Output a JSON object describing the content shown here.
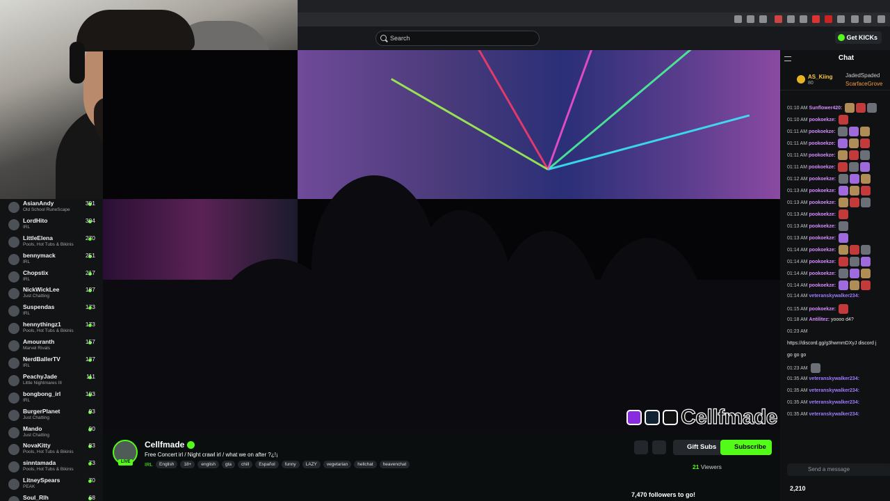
{
  "topnav": {
    "search_placeholder": "Search",
    "get_kicks_label": "Get KICKs"
  },
  "following": [
    {
      "name": "AsianAndy",
      "category": "Old School RuneScape",
      "viewers": "391"
    },
    {
      "name": "LordHito",
      "category": "IRL",
      "viewers": "304"
    },
    {
      "name": "LittleElena",
      "category": "Pools, Hot Tubs & Bikinis",
      "viewers": "270"
    },
    {
      "name": "bennymack",
      "category": "IRL",
      "viewers": "251"
    },
    {
      "name": "Chopstix",
      "category": "IRL",
      "viewers": "217"
    },
    {
      "name": "NickWickLee",
      "category": "Just Chatting",
      "viewers": "187"
    },
    {
      "name": "Suspendas",
      "category": "IRL",
      "viewers": "173"
    },
    {
      "name": "hennythingz1",
      "category": "Pools, Hot Tubs & Bikinis",
      "viewers": "173"
    },
    {
      "name": "Amouranth",
      "category": "Marvel Rivals",
      "viewers": "157"
    },
    {
      "name": "NerdBallerTV",
      "category": "IRL",
      "viewers": "137"
    },
    {
      "name": "PeachyJade",
      "category": "Little Nightmares III",
      "viewers": "111"
    },
    {
      "name": "bongbong_irl",
      "category": "IRL",
      "viewers": "103"
    },
    {
      "name": "BurgerPlanet",
      "category": "Just Chatting",
      "viewers": "93"
    },
    {
      "name": "Mando",
      "category": "Just Chatting",
      "viewers": "90"
    },
    {
      "name": "NovaKitty",
      "category": "Pools, Hot Tubs & Bikinis",
      "viewers": "83"
    },
    {
      "name": "sinntamada",
      "category": "Pools, Hot Tubs & Bikinis",
      "viewers": "73"
    },
    {
      "name": "LitneySpears",
      "category": "PEAK",
      "viewers": "70"
    },
    {
      "name": "Soul_Rlh",
      "category": "",
      "viewers": "68"
    }
  ],
  "video": {
    "overlay_name": "Cellfmade"
  },
  "stream": {
    "streamer": "Cellfmade",
    "live_badge": "LIVE",
    "title": "Free Concert irl / Night crawl irl / what we on after ?¿!¡",
    "category": "IRL",
    "tags": [
      "English",
      "18+",
      "english",
      "gta",
      "chill",
      "Español",
      "funny",
      "LAZY",
      "vegetarian",
      "hellchat",
      "heavenchat"
    ],
    "gift_subs_label": "Gift Subs",
    "subscribe_label": "Subscribe",
    "viewers_count": "21",
    "viewers_label": "Viewers",
    "followers_goal": "7,470 followers to go!"
  },
  "chat": {
    "title": "Chat",
    "gifters": [
      {
        "name": "AS_Kiing",
        "amount": "80"
      },
      {
        "name": "JadedSpaded"
      },
      {
        "name": "ScarfaceGrove"
      }
    ],
    "messages": [
      {
        "time": "01:10 AM",
        "user": "Sunflower420:",
        "text": "",
        "color": "#d58cff",
        "emotes": 3
      },
      {
        "time": "01:10 AM",
        "user": "pookoekze:",
        "text": "",
        "color": "#d58cff",
        "emotes": 1
      },
      {
        "time": "01:11 AM",
        "user": "pookoekze:",
        "text": "",
        "color": "#d58cff",
        "emotes": 3
      },
      {
        "time": "01:11 AM",
        "user": "pookoekze:",
        "text": "",
        "color": "#d58cff",
        "emotes": 3
      },
      {
        "time": "01:11 AM",
        "user": "pookoekze:",
        "text": "",
        "color": "#d58cff",
        "emotes": 3
      },
      {
        "time": "01:11 AM",
        "user": "pookoekze:",
        "text": "",
        "color": "#d58cff",
        "emotes": 3
      },
      {
        "time": "01:12 AM",
        "user": "pookoekze:",
        "text": "",
        "color": "#d58cff",
        "emotes": 3
      },
      {
        "time": "01:13 AM",
        "user": "pookoekze:",
        "text": "",
        "color": "#d58cff",
        "emotes": 3
      },
      {
        "time": "01:13 AM",
        "user": "pookoekze:",
        "text": "",
        "color": "#d58cff",
        "emotes": 3
      },
      {
        "time": "01:13 AM",
        "user": "pookoekze:",
        "text": "",
        "color": "#d58cff",
        "emotes": 1
      },
      {
        "time": "01:13 AM",
        "user": "pookoekze:",
        "text": "",
        "color": "#d58cff",
        "emotes": 1
      },
      {
        "time": "01:13 AM",
        "user": "pookoekze:",
        "text": "",
        "color": "#d58cff",
        "emotes": 1
      },
      {
        "time": "01:14 AM",
        "user": "pookoekze:",
        "text": "",
        "color": "#d58cff",
        "emotes": 3
      },
      {
        "time": "01:14 AM",
        "user": "pookoekze:",
        "text": "",
        "color": "#d58cff",
        "emotes": 3
      },
      {
        "time": "01:14 AM",
        "user": "pookoekze:",
        "text": "",
        "color": "#d58cff",
        "emotes": 3
      },
      {
        "time": "01:14 AM",
        "user": "pookoekze:",
        "text": "",
        "color": "#d58cff",
        "emotes": 3
      },
      {
        "time": "01:14 AM",
        "user": "veteranskywalker234:",
        "text": "",
        "color": "#9e7bff",
        "emotes": 0
      },
      {
        "time": "01:15 AM",
        "user": "pookoekze:",
        "text": "",
        "color": "#d58cff",
        "emotes": 1
      },
      {
        "time": "01:18 AM",
        "user": "Antilitez:",
        "text": "yoooo d4?",
        "color": "#d58cff",
        "emotes": 0
      },
      {
        "time": "01:23 AM",
        "user": "",
        "text": "",
        "color": "#ff4b4b",
        "emotes": 0
      },
      {
        "time": "",
        "user": "",
        "text": "https://discord.gg/g3hwmmDXyJ discord j",
        "color": "#ffffff",
        "emotes": 0
      },
      {
        "time": "",
        "user": "",
        "text": "go go go",
        "color": "#ffffff",
        "emotes": 0
      },
      {
        "time": "01:23 AM",
        "user": "",
        "text": "",
        "color": "#ff4b4b",
        "emotes": 1
      },
      {
        "time": "01:35 AM",
        "user": "veteranskywalker234:",
        "text": "",
        "color": "#9e7bff",
        "emotes": 0
      },
      {
        "time": "01:35 AM",
        "user": "veteranskywalker234:",
        "text": "",
        "color": "#9e7bff",
        "emotes": 0
      },
      {
        "time": "01:35 AM",
        "user": "veteranskywalker234:",
        "text": "",
        "color": "#9e7bff",
        "emotes": 0
      },
      {
        "time": "01:35 AM",
        "user": "veteranskywalker234:",
        "text": "",
        "color": "#9e7bff",
        "emotes": 0
      }
    ],
    "input_placeholder": "Send a message",
    "points": "2,210"
  },
  "colors": {
    "accent": "#53fc18",
    "background": "#0b0e0f"
  }
}
